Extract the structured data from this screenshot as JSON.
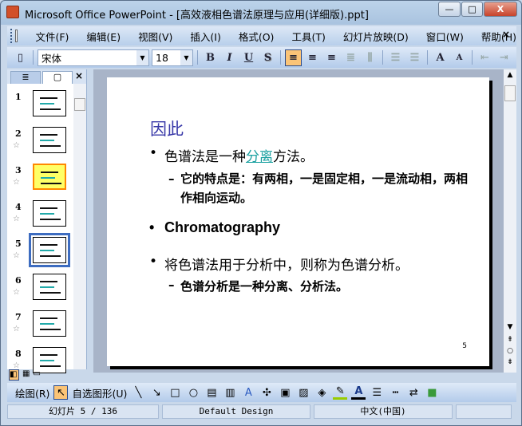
{
  "window": {
    "title": "Microsoft Office PowerPoint - [高效液相色谱法原理与应用(详细版).ppt]",
    "min": "—",
    "max": "□",
    "close": "X"
  },
  "menu": [
    "文件(F)",
    "编辑(E)",
    "视图(V)",
    "插入(I)",
    "格式(O)",
    "工具(T)",
    "幻灯片放映(D)",
    "窗口(W)",
    "帮助(H)"
  ],
  "menu_close": "×",
  "toolbar": {
    "font": "宋体",
    "size": "18",
    "bold": "B",
    "italic": "I",
    "underline": "U",
    "shadow": "S",
    "grow": "A",
    "shrink": "A"
  },
  "pane": {
    "close": "×",
    "slides": [
      {
        "n": "1"
      },
      {
        "n": "2"
      },
      {
        "n": "3"
      },
      {
        "n": "4"
      },
      {
        "n": "5"
      },
      {
        "n": "6"
      },
      {
        "n": "7"
      },
      {
        "n": "8"
      }
    ],
    "star": "☆"
  },
  "slide": {
    "title": "因此",
    "b1_pre": "色谱法是一种",
    "b1_link": "分离",
    "b1_post": "方法。",
    "s1": "它的特点是：有两相，一是固定相，一是流动相，两相作相向运动。",
    "b2": "Chromatography",
    "b3": "将色谱法用于分析中，则称为色谱分析。",
    "s3": "色谱分析是一种分离、分析法。",
    "page": "5"
  },
  "drawbar": {
    "draw": "绘图(R)",
    "autoshapes": "自选图形(U)"
  },
  "status": {
    "slide": "幻灯片 5 / 136",
    "design": "Default Design",
    "lang": "中文(中国)"
  }
}
